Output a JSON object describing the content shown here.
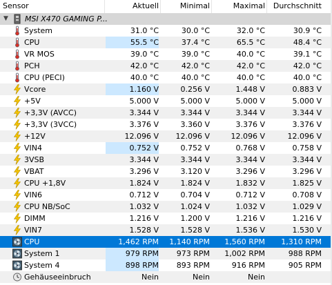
{
  "header": {
    "sensor": "Sensor",
    "current": "Aktuell",
    "minimum": "Minimal",
    "maximum": "Maximal",
    "average": "Durchschnitt"
  },
  "group": {
    "title": "MSI X470 GAMING P..."
  },
  "rows": [
    {
      "name": "System",
      "icon": "thermometer-icon",
      "current": "31.0 °C",
      "min": "30.0 °C",
      "max": "32.0 °C",
      "avg": "30.9 °C",
      "highlight": false
    },
    {
      "name": "CPU",
      "icon": "thermometer-icon",
      "current": "55.5 °C",
      "min": "37.4 °C",
      "max": "65.5 °C",
      "avg": "48.4 °C",
      "highlight": true
    },
    {
      "name": "VR MOS",
      "icon": "thermometer-icon",
      "current": "39.0 °C",
      "min": "39.0 °C",
      "max": "40.0 °C",
      "avg": "39.1 °C",
      "highlight": false
    },
    {
      "name": "PCH",
      "icon": "thermometer-icon",
      "current": "42.0 °C",
      "min": "42.0 °C",
      "max": "42.0 °C",
      "avg": "42.0 °C",
      "highlight": false
    },
    {
      "name": "CPU (PECI)",
      "icon": "thermometer-icon",
      "current": "40.0 °C",
      "min": "40.0 °C",
      "max": "40.0 °C",
      "avg": "40.0 °C",
      "highlight": false
    },
    {
      "name": "Vcore",
      "icon": "lightning-icon",
      "current": "1.160 V",
      "min": "0.256 V",
      "max": "1.448 V",
      "avg": "0.883 V",
      "highlight": true
    },
    {
      "name": "+5V",
      "icon": "lightning-icon",
      "current": "5.000 V",
      "min": "5.000 V",
      "max": "5.000 V",
      "avg": "5.000 V",
      "highlight": false
    },
    {
      "name": "+3,3V (AVCC)",
      "icon": "lightning-icon",
      "current": "3.344 V",
      "min": "3.344 V",
      "max": "3.344 V",
      "avg": "3.344 V",
      "highlight": false
    },
    {
      "name": "+3,3V (3VCC)",
      "icon": "lightning-icon",
      "current": "3.376 V",
      "min": "3.360 V",
      "max": "3.376 V",
      "avg": "3.376 V",
      "highlight": false
    },
    {
      "name": "+12V",
      "icon": "lightning-icon",
      "current": "12.096 V",
      "min": "12.096 V",
      "max": "12.096 V",
      "avg": "12.096 V",
      "highlight": false
    },
    {
      "name": "VIN4",
      "icon": "lightning-icon",
      "current": "0.752 V",
      "min": "0.752 V",
      "max": "0.768 V",
      "avg": "0.758 V",
      "highlight": true
    },
    {
      "name": "3VSB",
      "icon": "lightning-icon",
      "current": "3.344 V",
      "min": "3.344 V",
      "max": "3.344 V",
      "avg": "3.344 V",
      "highlight": false
    },
    {
      "name": "VBAT",
      "icon": "lightning-icon",
      "current": "3.296 V",
      "min": "3.120 V",
      "max": "3.296 V",
      "avg": "3.296 V",
      "highlight": false
    },
    {
      "name": "CPU +1,8V",
      "icon": "lightning-icon",
      "current": "1.824 V",
      "min": "1.824 V",
      "max": "1.832 V",
      "avg": "1.825 V",
      "highlight": false
    },
    {
      "name": "VIN6",
      "icon": "lightning-icon",
      "current": "0.712 V",
      "min": "0.704 V",
      "max": "0.712 V",
      "avg": "0.708 V",
      "highlight": false
    },
    {
      "name": "CPU NB/SoC",
      "icon": "lightning-icon",
      "current": "1.032 V",
      "min": "1.024 V",
      "max": "1.032 V",
      "avg": "1.029 V",
      "highlight": false
    },
    {
      "name": "DIMM",
      "icon": "lightning-icon",
      "current": "1.216 V",
      "min": "1.200 V",
      "max": "1.216 V",
      "avg": "1.216 V",
      "highlight": false
    },
    {
      "name": "VIN7",
      "icon": "lightning-icon",
      "current": "1.528 V",
      "min": "1.528 V",
      "max": "1.536 V",
      "avg": "1.530 V",
      "highlight": false
    },
    {
      "name": "CPU",
      "icon": "fan-icon",
      "current": "1,462 RPM",
      "min": "1,140 RPM",
      "max": "1,560 RPM",
      "avg": "1,310 RPM",
      "highlight": true,
      "selected": true
    },
    {
      "name": "System 1",
      "icon": "fan-icon",
      "current": "979 RPM",
      "min": "973 RPM",
      "max": "1,002 RPM",
      "avg": "988 RPM",
      "highlight": true
    },
    {
      "name": "System 4",
      "icon": "fan-icon",
      "current": "898 RPM",
      "min": "893 RPM",
      "max": "916 RPM",
      "avg": "905 RPM",
      "highlight": true
    },
    {
      "name": "Gehäuseeinbruch",
      "icon": "shield-clock-icon",
      "current": "Nein",
      "min": "Nein",
      "max": "Nein",
      "avg": "",
      "highlight": false
    }
  ],
  "colors": {
    "selection": "#0078d7",
    "highlight": "#cce8ff",
    "group": "#d7d7d7",
    "alt_row": "#f0f0f0"
  }
}
